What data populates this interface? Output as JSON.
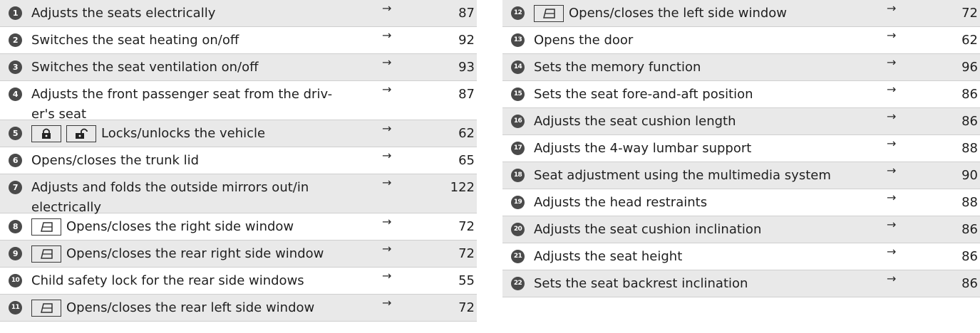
{
  "left_items": [
    {
      "num": "1",
      "text_lines": [
        "Adjusts the seats electrically"
      ],
      "keys": [],
      "arrow": "→",
      "page": "87"
    },
    {
      "num": "2",
      "text_lines": [
        "Switches the seat heating on/off"
      ],
      "keys": [],
      "arrow": "→",
      "page": "92"
    },
    {
      "num": "3",
      "text_lines": [
        "Switches the seat ventilation on/off"
      ],
      "keys": [],
      "arrow": "→",
      "page": "93"
    },
    {
      "num": "4",
      "text_lines": [
        "Adjusts the front passenger seat from the driv-",
        "er's seat"
      ],
      "keys": [],
      "arrow": "→",
      "page": "87"
    },
    {
      "num": "5",
      "text_lines": [
        "Locks/unlocks the vehicle"
      ],
      "keys": [
        "lock-icon",
        "unlock-icon"
      ],
      "arrow": "→",
      "page": "62"
    },
    {
      "num": "6",
      "text_lines": [
        "Opens/closes the trunk lid"
      ],
      "keys": [],
      "arrow": "→",
      "page": "65"
    },
    {
      "num": "7",
      "text_lines": [
        "Adjusts and folds the outside mirrors out/in",
        "electrically"
      ],
      "keys": [],
      "arrow": "→",
      "page": "122"
    },
    {
      "num": "8",
      "text_lines": [
        "Opens/closes the right side window"
      ],
      "keys": [
        "window-icon"
      ],
      "arrow": "→",
      "page": "72"
    },
    {
      "num": "9",
      "text_lines": [
        "Opens/closes the rear right side window"
      ],
      "keys": [
        "window-icon"
      ],
      "arrow": "→",
      "page": "72"
    },
    {
      "num": "10",
      "text_lines": [
        "Child safety lock for the rear side windows"
      ],
      "keys": [],
      "arrow": "→",
      "page": "55"
    },
    {
      "num": "11",
      "text_lines": [
        "Opens/closes the rear left side window"
      ],
      "keys": [
        "window-icon"
      ],
      "arrow": "→",
      "page": "72"
    }
  ],
  "right_items": [
    {
      "num": "12",
      "text_lines": [
        "Opens/closes the left side window"
      ],
      "keys": [
        "window-icon"
      ],
      "arrow": "→",
      "page": "72"
    },
    {
      "num": "13",
      "text_lines": [
        "Opens the door"
      ],
      "keys": [],
      "arrow": "→",
      "page": "62"
    },
    {
      "num": "14",
      "text_lines": [
        "Sets the memory function"
      ],
      "keys": [],
      "arrow": "→",
      "page": "96"
    },
    {
      "num": "15",
      "text_lines": [
        "Sets the seat fore-and-aft position"
      ],
      "keys": [],
      "arrow": "→",
      "page": "86"
    },
    {
      "num": "16",
      "text_lines": [
        "Adjusts the seat cushion length"
      ],
      "keys": [],
      "arrow": "→",
      "page": "86"
    },
    {
      "num": "17",
      "text_lines": [
        "Adjusts the 4-way lumbar support"
      ],
      "keys": [],
      "arrow": "→",
      "page": "88"
    },
    {
      "num": "18",
      "text_lines": [
        "Seat adjustment using the multimedia system"
      ],
      "keys": [],
      "arrow": "→",
      "page": "90"
    },
    {
      "num": "19",
      "text_lines": [
        "Adjusts the head restraints"
      ],
      "keys": [],
      "arrow": "→",
      "page": "88"
    },
    {
      "num": "20",
      "text_lines": [
        "Adjusts the seat cushion inclination"
      ],
      "keys": [],
      "arrow": "→",
      "page": "86"
    },
    {
      "num": "21",
      "text_lines": [
        "Adjusts the seat height"
      ],
      "keys": [],
      "arrow": "→",
      "page": "86"
    },
    {
      "num": "22",
      "text_lines": [
        "Sets the seat backrest inclination"
      ],
      "keys": [],
      "arrow": "→",
      "page": "86"
    }
  ],
  "colors": {
    "row_shade": "#e9e9e9",
    "badge": "#4a4a4a",
    "divider": "#cfcfcf",
    "text": "#1f1f1f"
  }
}
